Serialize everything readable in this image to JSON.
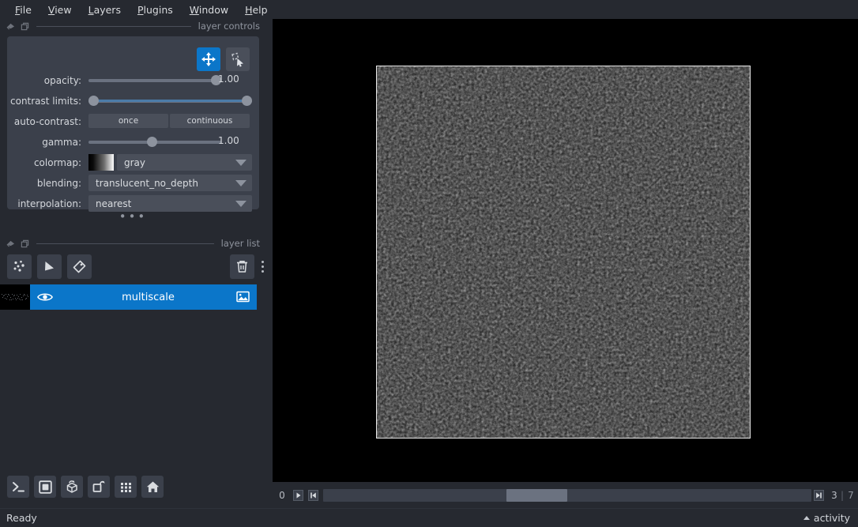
{
  "menubar": {
    "items": [
      {
        "label": "File",
        "mnemonic": "F"
      },
      {
        "label": "View",
        "mnemonic": "V"
      },
      {
        "label": "Layers",
        "mnemonic": "L"
      },
      {
        "label": "Plugins",
        "mnemonic": "P"
      },
      {
        "label": "Window",
        "mnemonic": "W"
      },
      {
        "label": "Help",
        "mnemonic": "H"
      }
    ]
  },
  "layer_controls": {
    "dock_title": "layer controls",
    "mode_buttons": [
      {
        "name": "pan-zoom-icon",
        "active": true
      },
      {
        "name": "transform-icon",
        "active": false
      }
    ],
    "opacity": {
      "label": "opacity:",
      "value": "1.00",
      "percent": 100
    },
    "contrast_limits": {
      "label": "contrast limits:",
      "low_percent": 0,
      "high_percent": 100
    },
    "auto_contrast": {
      "label": "auto-contrast:",
      "once": "once",
      "continuous": "continuous"
    },
    "gamma": {
      "label": "gamma:",
      "value": "1.00",
      "percent": 50
    },
    "colormap": {
      "label": "colormap:",
      "value": "gray"
    },
    "blending": {
      "label": "blending:",
      "value": "translucent_no_depth"
    },
    "interpolation": {
      "label": "interpolation:",
      "value": "nearest"
    }
  },
  "layer_list": {
    "dock_title": "layer list",
    "tools": [
      {
        "name": "new-points-icon",
        "title": "New points layer"
      },
      {
        "name": "new-shapes-icon",
        "title": "New shapes layer"
      },
      {
        "name": "new-labels-icon",
        "title": "New labels layer"
      },
      {
        "name": "delete-icon",
        "title": "Delete selected layers"
      }
    ],
    "layers": [
      {
        "name": "multiscale",
        "visible": true,
        "selected": true,
        "type_icon": "image-layer-icon"
      }
    ]
  },
  "viewer_buttons": [
    {
      "name": "console-icon",
      "title": "Open IPython console"
    },
    {
      "name": "ndisplay-2d-icon",
      "title": "Toggle 2D/3D view"
    },
    {
      "name": "roll-dims-icon",
      "title": "Roll dimensions order"
    },
    {
      "name": "transpose-dims-icon",
      "title": "Transpose displayed dimensions"
    },
    {
      "name": "grid-view-icon",
      "title": "Toggle grid view"
    },
    {
      "name": "home-icon",
      "title": "Reset view"
    }
  ],
  "dims": {
    "axis_index": "0",
    "current": "3",
    "separator": "|",
    "max": "7",
    "handle_left_percent": 37.5,
    "handle_width_percent": 12.5,
    "play_icon": "play-icon",
    "first_icon": "step-first-icon",
    "last_icon": "step-last-icon"
  },
  "statusbar": {
    "status": "Ready",
    "activity_label": "activity",
    "activity_icon": "chevron-up-icon"
  },
  "colors": {
    "accent": "#0b76c9",
    "panel_bg": "#3b404b",
    "window_bg": "#262930",
    "canvas_bg": "#000000",
    "text": "#d4d7dc",
    "muted_text": "#8f949e",
    "slider_track": "#6b7280",
    "slider_selected": "#4b7ba8",
    "image_border": "#e8e8e8"
  }
}
